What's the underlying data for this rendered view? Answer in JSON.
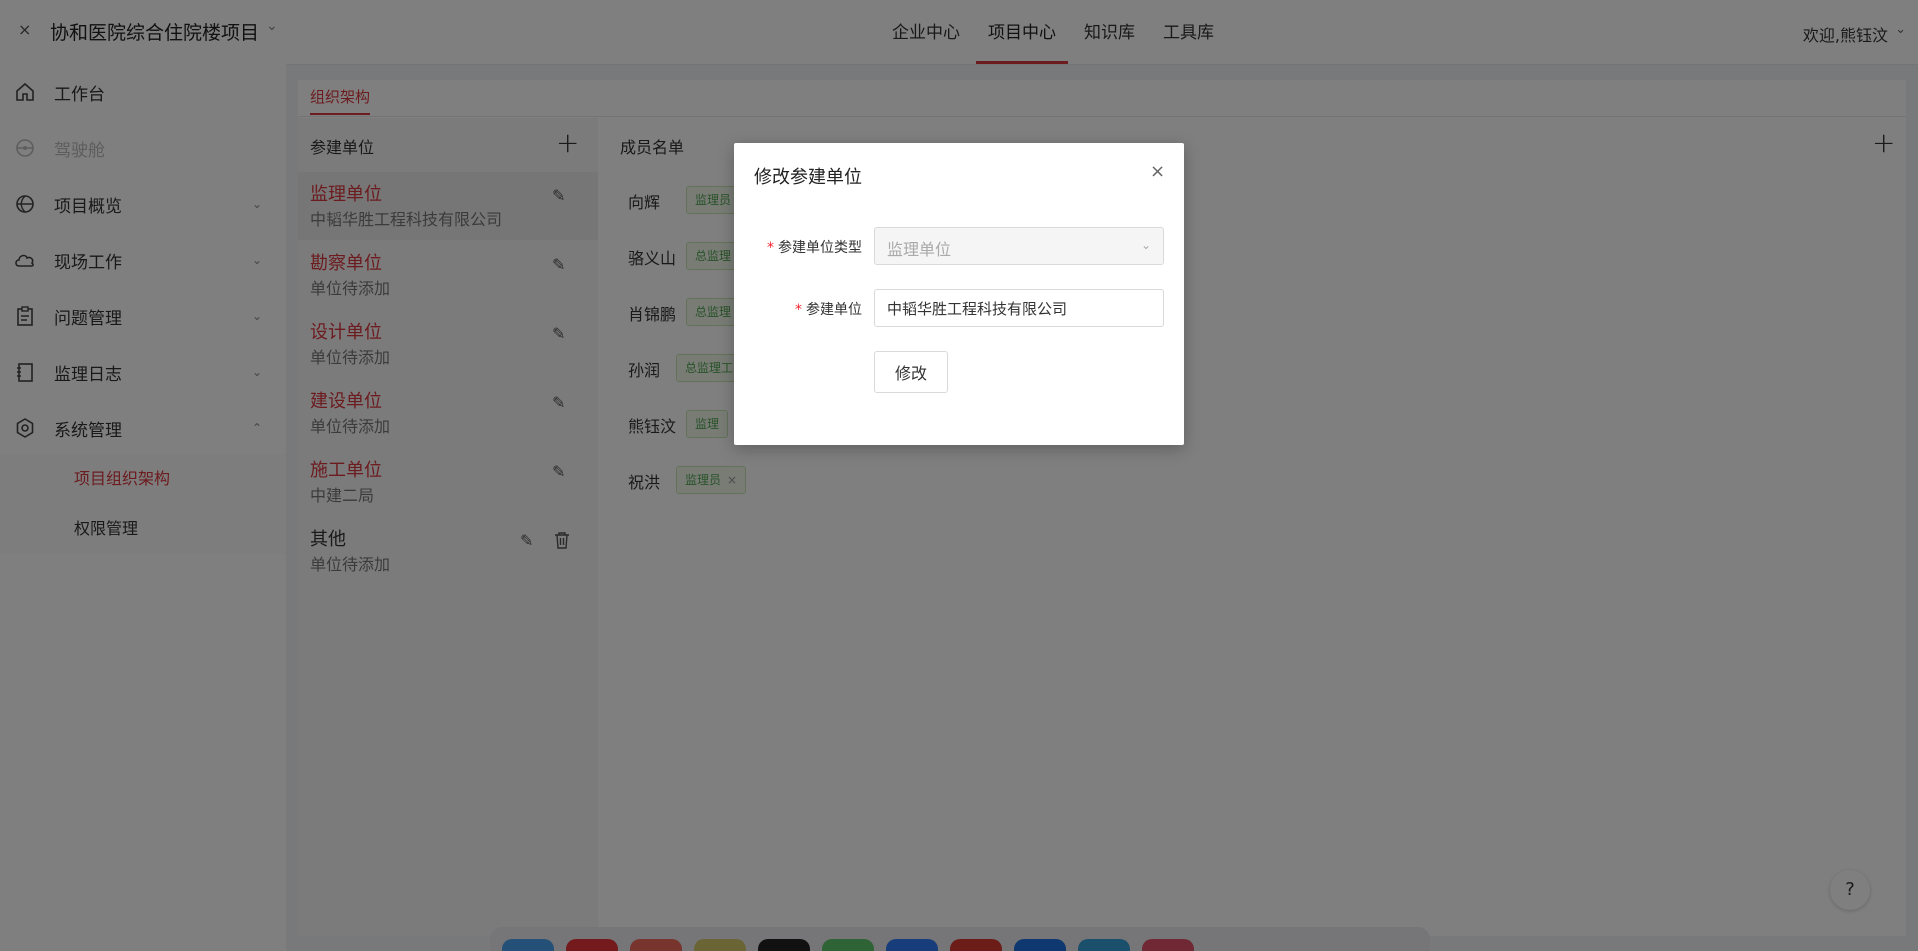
{
  "topbar": {
    "close_glyph": "×",
    "project_title": "协和医院综合住院楼项目",
    "project_caret": "⌄",
    "nav": [
      {
        "label": "企业中心"
      },
      {
        "label": "项目中心"
      },
      {
        "label": "知识库"
      },
      {
        "label": "工具库"
      }
    ],
    "active_nav": "项目中心",
    "welcome": "欢迎,熊钰汶",
    "welcome_caret": "⌄"
  },
  "sidebar": {
    "items": [
      {
        "label": "工作台",
        "icon": "home-icon"
      },
      {
        "label": "驾驶舱",
        "icon": "steering-icon"
      },
      {
        "label": "项目概览",
        "icon": "globe-icon",
        "caret": "⌄"
      },
      {
        "label": "现场工作",
        "icon": "cloud-icon",
        "caret": "⌄"
      },
      {
        "label": "问题管理",
        "icon": "clipboard-icon",
        "caret": "⌄"
      },
      {
        "label": "监理日志",
        "icon": "notebook-icon",
        "caret": "⌄"
      },
      {
        "label": "系统管理",
        "icon": "settings-icon",
        "caret": "⌃"
      }
    ],
    "subitems": [
      {
        "label": "项目组织架构",
        "active": true
      },
      {
        "label": "权限管理",
        "active": false
      }
    ]
  },
  "main": {
    "tab": "组织架构",
    "units_header": "参建单位",
    "add_glyph": "+",
    "edit_glyph": "✎",
    "units": [
      {
        "title": "监理单位",
        "subtitle": "中韬华胜工程科技有限公司"
      },
      {
        "title": "勘察单位",
        "subtitle": "单位待添加"
      },
      {
        "title": "设计单位",
        "subtitle": "单位待添加"
      },
      {
        "title": "建设单位",
        "subtitle": "单位待添加"
      },
      {
        "title": "施工单位",
        "subtitle": "中建二局"
      },
      {
        "title": "其他",
        "subtitle": "单位待添加"
      }
    ],
    "members_header": "成员名单",
    "members": [
      {
        "name": "向辉",
        "tag": "监理员"
      },
      {
        "name": "骆义山",
        "tag": "总监理"
      },
      {
        "name": "肖锦鹏",
        "tag": "总监理"
      },
      {
        "name": "孙润",
        "tag": "总监理工"
      },
      {
        "name": "熊钰汶",
        "tag": "监理"
      },
      {
        "name": "祝洪",
        "tag": "监理员",
        "tag_close": "×"
      }
    ]
  },
  "modal": {
    "title": "修改参建单位",
    "close_glyph": "×",
    "required_mark": "*",
    "type_label": "参建单位类型",
    "type_value": "监理单位",
    "type_caret": "⌄",
    "unit_label": "参建单位",
    "unit_value": "中韬华胜工程科技有限公司",
    "submit_label": "修改"
  },
  "help": {
    "label": "?"
  },
  "dock_colors": [
    "#4aa3f0",
    "#e8343b",
    "#f06a5a",
    "#d6c86a",
    "#222222",
    "#5cc66a",
    "#2f7cf6",
    "#d93a2f",
    "#1e6fe0",
    "#37a0d8",
    "#e0506a"
  ]
}
